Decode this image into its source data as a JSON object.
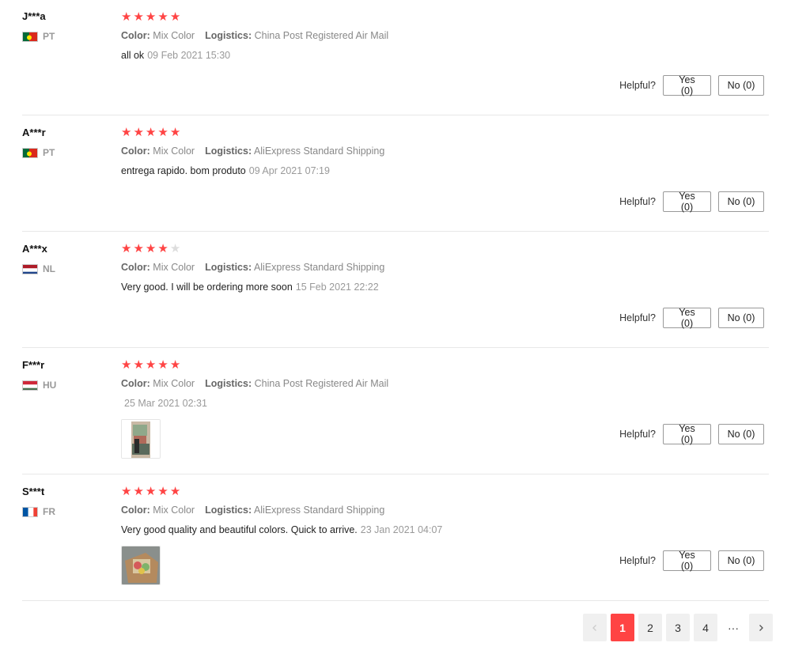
{
  "colors": {
    "star": "#ff4444",
    "active_page": "#ff4444"
  },
  "labels": {
    "color": "Color:",
    "logistics": "Logistics:",
    "helpful": "Helpful?"
  },
  "reviews": [
    {
      "user": "J***a",
      "country": "PT",
      "flag": "portugal",
      "rating": 5,
      "color": "Mix Color",
      "logistics": "China Post Registered Air Mail",
      "text": "all ok",
      "date": "09 Feb 2021 15:30",
      "yes": "Yes (0)",
      "no": "No (0)",
      "has_image": false
    },
    {
      "user": "A***r",
      "country": "PT",
      "flag": "portugal",
      "rating": 5,
      "color": "Mix Color",
      "logistics": "AliExpress Standard Shipping",
      "text": "entrega rapido. bom produto",
      "date": "09 Apr 2021 07:19",
      "yes": "Yes (0)",
      "no": "No (0)",
      "has_image": false
    },
    {
      "user": "A***x",
      "country": "NL",
      "flag": "netherlands",
      "rating": 4,
      "color": "Mix Color",
      "logistics": "AliExpress Standard Shipping",
      "text": "Very good. I will be ordering more soon",
      "date": "15 Feb 2021 22:22",
      "yes": "Yes (0)",
      "no": "No (0)",
      "has_image": false
    },
    {
      "user": "F***r",
      "country": "HU",
      "flag": "hungary",
      "rating": 5,
      "color": "Mix Color",
      "logistics": "China Post Registered Air Mail",
      "text": "",
      "date": "25 Mar 2021 02:31",
      "yes": "Yes (0)",
      "no": "No (0)",
      "has_image": true
    },
    {
      "user": "S***t",
      "country": "FR",
      "flag": "france",
      "rating": 5,
      "color": "Mix Color",
      "logistics": "AliExpress Standard Shipping",
      "text": "Very good quality and beautiful colors. Quick to arrive.",
      "date": "23 Jan 2021 04:07",
      "yes": "Yes (0)",
      "no": "No (0)",
      "has_image": true
    }
  ],
  "pagination": {
    "prev_icon": "chevron-left-icon",
    "pages": [
      "1",
      "2",
      "3",
      "4"
    ],
    "current": "1",
    "ellipsis": "···",
    "next_icon": "chevron-right-icon"
  }
}
